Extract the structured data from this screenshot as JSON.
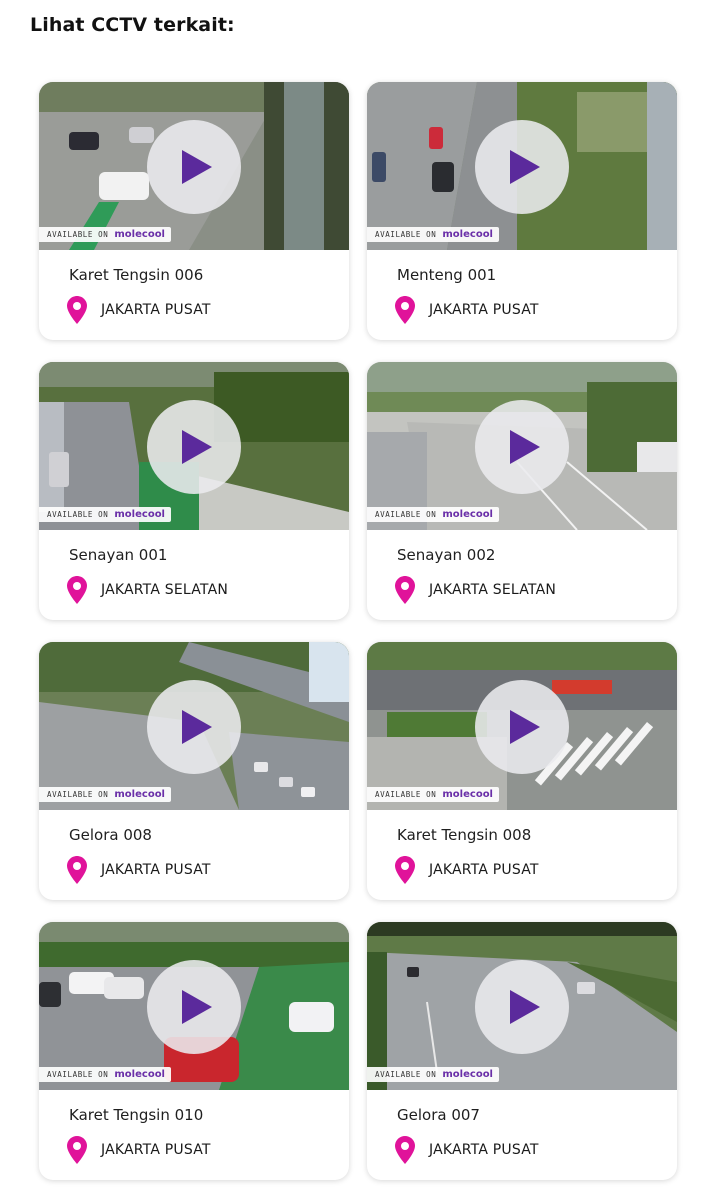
{
  "heading": "Lihat CCTV terkait:",
  "badge": {
    "available_text": "AVAILABLE ON",
    "brand": "molecool"
  },
  "colors": {
    "play_triangle": "#5b2a9c",
    "pin": "#e0139a",
    "brand": "#6a2fa8"
  },
  "icons": {
    "play": "play-icon",
    "location": "location-pin-icon"
  },
  "cards": [
    {
      "name": "Karet Tengsin 006",
      "location": "JAKARTA PUSAT"
    },
    {
      "name": "Menteng 001",
      "location": "JAKARTA PUSAT"
    },
    {
      "name": "Senayan 001",
      "location": "JAKARTA SELATAN"
    },
    {
      "name": "Senayan 002",
      "location": "JAKARTA SELATAN"
    },
    {
      "name": "Gelora 008",
      "location": "JAKARTA PUSAT"
    },
    {
      "name": "Karet Tengsin 008",
      "location": "JAKARTA PUSAT"
    },
    {
      "name": "Karet Tengsin 010",
      "location": "JAKARTA PUSAT"
    },
    {
      "name": "Gelora 007",
      "location": "JAKARTA PUSAT"
    }
  ]
}
